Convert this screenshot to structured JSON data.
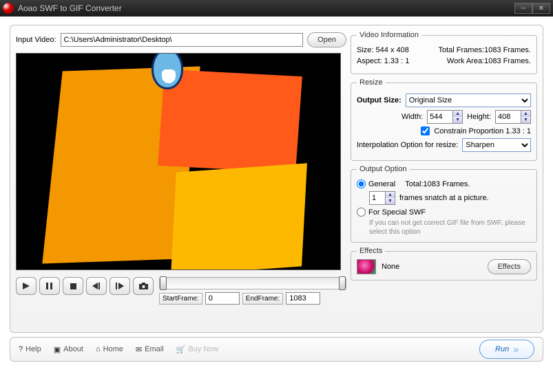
{
  "window": {
    "title": "Aoao SWF to GIF Converter"
  },
  "input": {
    "label": "Input Video:",
    "path": "C:\\Users\\Administrator\\Desktop\\",
    "open": "Open"
  },
  "frames": {
    "startLabel": "StartFrame:",
    "start": "0",
    "endLabel": "EndFrame:",
    "end": "1083"
  },
  "videoInfo": {
    "legend": "Video Information",
    "sizeLabel": "Size:",
    "size": "544 x 408",
    "totalLabel": "Total Frames:",
    "total": "1083 Frames.",
    "aspectLabel": "Aspect:",
    "aspect": "1.33 : 1",
    "workLabel": "Work Area:",
    "work": "1083 Frames."
  },
  "resize": {
    "legend": "Resize",
    "outputSizeLabel": "Output Size:",
    "outputSize": "Original Size",
    "widthLabel": "Width:",
    "width": "544",
    "heightLabel": "Height:",
    "height": "408",
    "constrain": "Constrain Proportion  1.33 : 1",
    "interpLabel": "Interpolation Option for resize:",
    "interp": "Sharpen"
  },
  "output": {
    "legend": "Output Option",
    "general": "General",
    "totalText": "Total:1083 Frames.",
    "snatchCount": "1",
    "snatchText": "frames snatch at a picture.",
    "special": "For Special SWF",
    "specialNote": "If you can not get correct GIF file from SWF, please select this option"
  },
  "effects": {
    "legend": "Effects",
    "name": "None",
    "button": "Effects"
  },
  "footer": {
    "help": "Help",
    "about": "About",
    "home": "Home",
    "email": "Email",
    "buy": "Buy Now",
    "run": "Run"
  }
}
